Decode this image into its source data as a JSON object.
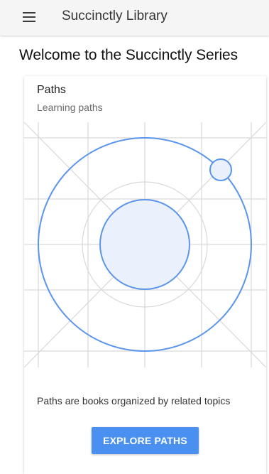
{
  "toolbar": {
    "menu_icon": "hamburger-menu-icon",
    "title": "Succinctly Library"
  },
  "page": {
    "heading": "Welcome to the Succinctly Series"
  },
  "card": {
    "title": "Paths",
    "subtitle": "Learning paths",
    "illustration_icon": "learning-paths-orbit-illustration",
    "description": "Paths are books organized by related topics",
    "button_label": "EXPLORE PATHS"
  },
  "colors": {
    "toolbar_bg": "#f5f5f5",
    "accent_blue": "#4a90f0",
    "illustration_line": "#5b95ea",
    "illustration_fill": "#eaf1fd",
    "grid_line": "#d9d9d9"
  }
}
